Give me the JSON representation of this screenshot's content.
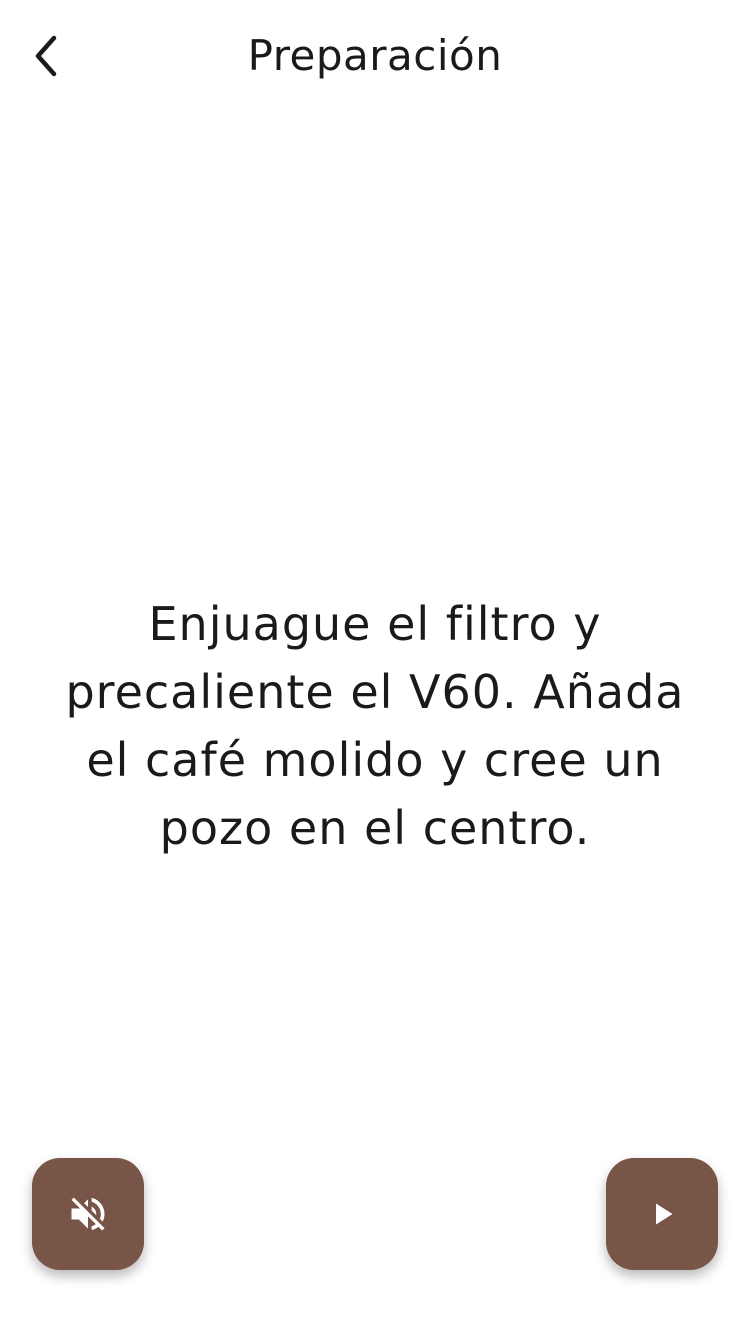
{
  "header": {
    "title": "Preparación",
    "back_icon": "chevron-left-icon"
  },
  "step": {
    "instruction": "Enjuague el filtro y precaliente el V60. Añada el café molido y cree un pozo en el centro."
  },
  "controls": {
    "mute_icon": "volume-off-icon",
    "play_icon": "play-icon",
    "accent_color": "#795548",
    "icon_color": "#ffffff"
  }
}
